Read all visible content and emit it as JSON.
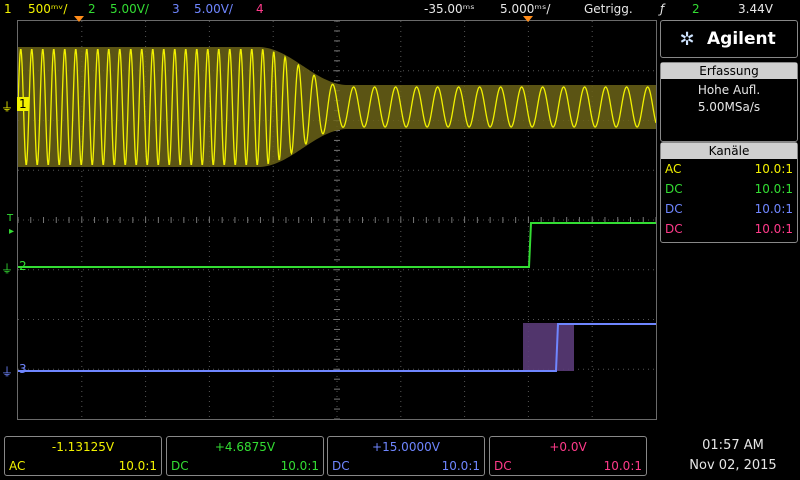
{
  "topbar": {
    "ch1": {
      "num": "1",
      "scale": "500",
      "unit": "ᵐᵛ/"
    },
    "ch2": {
      "num": "2",
      "scale": "5.00V/"
    },
    "ch3": {
      "num": "3",
      "scale": "5.00V/"
    },
    "ch4": {
      "num": "4"
    },
    "time_offset": "-35.00",
    "time_offset_unit": "ᵐˢ",
    "timebase": "5.000",
    "timebase_unit": "ᵐˢ/",
    "trigger_mode": "Getrigg.",
    "trigger_icon": "trigger-edge-icon",
    "trigger_source": "2",
    "trigger_level": "3.44V"
  },
  "panel": {
    "brand": "Agilent",
    "acq_header": "Erfassung",
    "acq_mode": "Hohe Aufl.",
    "sample_rate": "5.00MSa/s",
    "chan_header": "Kanäle",
    "channels": [
      {
        "coupling": "AC",
        "probe": "10.0:1",
        "color": "#f2f200"
      },
      {
        "coupling": "DC",
        "probe": "10.0:1",
        "color": "#33dd33"
      },
      {
        "coupling": "DC",
        "probe": "10.0:1",
        "color": "#6f86ff"
      },
      {
        "coupling": "DC",
        "probe": "10.0:1",
        "color": "#ff3a8a"
      }
    ]
  },
  "markers": {
    "ch1": "1",
    "ch2": "2",
    "ch3": "3",
    "trig": "T"
  },
  "bottom": [
    {
      "offset": "-1.13125V",
      "coupling": "AC",
      "probe": "10.0:1"
    },
    {
      "offset": "+4.6875V",
      "coupling": "DC",
      "probe": "10.0:1"
    },
    {
      "offset": "+15.0000V",
      "coupling": "DC",
      "probe": "10.0:1"
    },
    {
      "offset": "+0.0V",
      "coupling": "DC",
      "probe": "10.0:1"
    }
  ],
  "clock": {
    "time": "01:57 AM",
    "date": "Nov 02, 2015"
  }
}
